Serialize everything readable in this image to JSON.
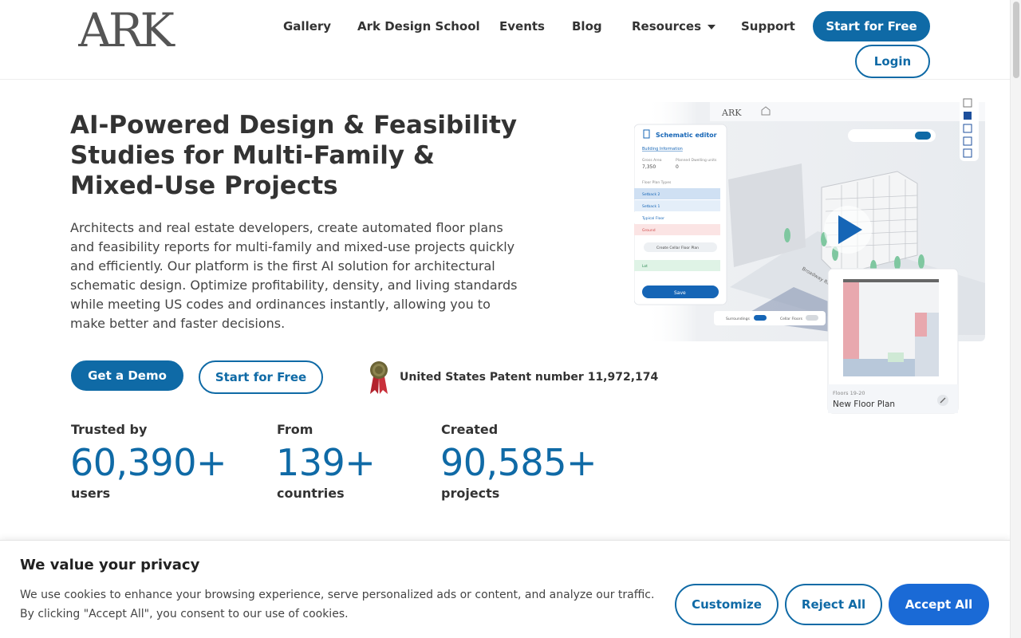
{
  "header": {
    "logo_alt": "ARK",
    "nav": [
      "Gallery",
      "Ark Design School",
      "Events",
      "Blog",
      "Resources",
      "Support"
    ],
    "start_free": "Start for Free",
    "login": "Login"
  },
  "hero": {
    "title": "AI-Powered Design & Feasibility Studies for Multi-Family & Mixed-Use Projects",
    "description": "Architects and real estate developers, create automated floor plans and feasibility reports for multi-family and mixed-use projects quickly and efficiently. Our platform is the first AI solution for architectural schematic design. Optimize profitability, density, and living standards while meeting US codes and ordinances instantly, allowing you to make better and faster decisions.",
    "get_demo": "Get a Demo",
    "start_free": "Start for Free",
    "patent": "United States Patent number 11,972,174"
  },
  "stats": [
    {
      "label_top": "Trusted by",
      "value": "60,390+",
      "label_bottom": "users"
    },
    {
      "label_top": "From",
      "value": "139+",
      "label_bottom": "countries"
    },
    {
      "label_top": "Created",
      "value": "90,585+",
      "label_bottom": "projects"
    }
  ],
  "preview": {
    "app_logo": "ARK",
    "panel_title": "Schematic editor",
    "building_info": "Building Information",
    "gross_area_label": "Gross Area",
    "gross_area": "7,350",
    "dwelling_label": "Planned Dwelling units",
    "dwelling": "0",
    "floor_plan_types": "Floor Plan Types",
    "floors": [
      "Setback 2",
      "Setback 1",
      "Typical Floor",
      "Ground"
    ],
    "create_cellar": "Create Cellar Floor Plan",
    "lot": "Lot",
    "save": "Save",
    "surroundings": "Surroundings",
    "cellar_floors": "Cellar Floors",
    "street": "Broadway Rd",
    "card_floors": "Floors 19-20",
    "card_title": "New Floor Plan"
  },
  "cookie": {
    "title": "We value your privacy",
    "text": "We use cookies to enhance your browsing experience, serve personalized ads or content, and analyze our traffic. By clicking \"Accept All\", you consent to our use of cookies.",
    "customize": "Customize",
    "reject": "Reject All",
    "accept": "Accept All"
  },
  "colors": {
    "brand": "#0f6aa6",
    "accept": "#1a6ad6",
    "text": "#333333"
  }
}
